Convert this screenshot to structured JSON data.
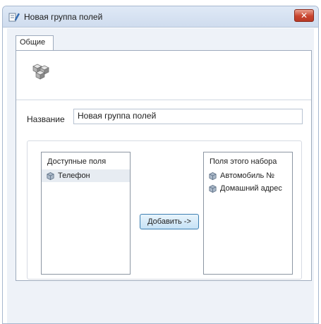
{
  "window": {
    "title": "Новая группа полей",
    "close_symbol": "✕"
  },
  "tabs": [
    {
      "label": "Общие",
      "selected": true
    }
  ],
  "form": {
    "name_label": "Название",
    "name_value": "Новая группа полей"
  },
  "available": {
    "title": "Доступные поля",
    "items": [
      {
        "label": "Телефон",
        "selected": true
      }
    ]
  },
  "add_button": {
    "label": "Добавить ->"
  },
  "selected_set": {
    "title": "Поля этого набора",
    "items": [
      {
        "label": "Автомобиль №"
      },
      {
        "label": "Домашний адрес"
      }
    ]
  },
  "icons": {
    "window": "form-edit-icon",
    "header": "cubes-icon",
    "list_item": "field-bubble-icon"
  },
  "colors": {
    "titlebar": "#d8e4f3",
    "close_button": "#c9442f",
    "client_background": "#eef2f8",
    "button_accent": "#3c7fb1"
  }
}
